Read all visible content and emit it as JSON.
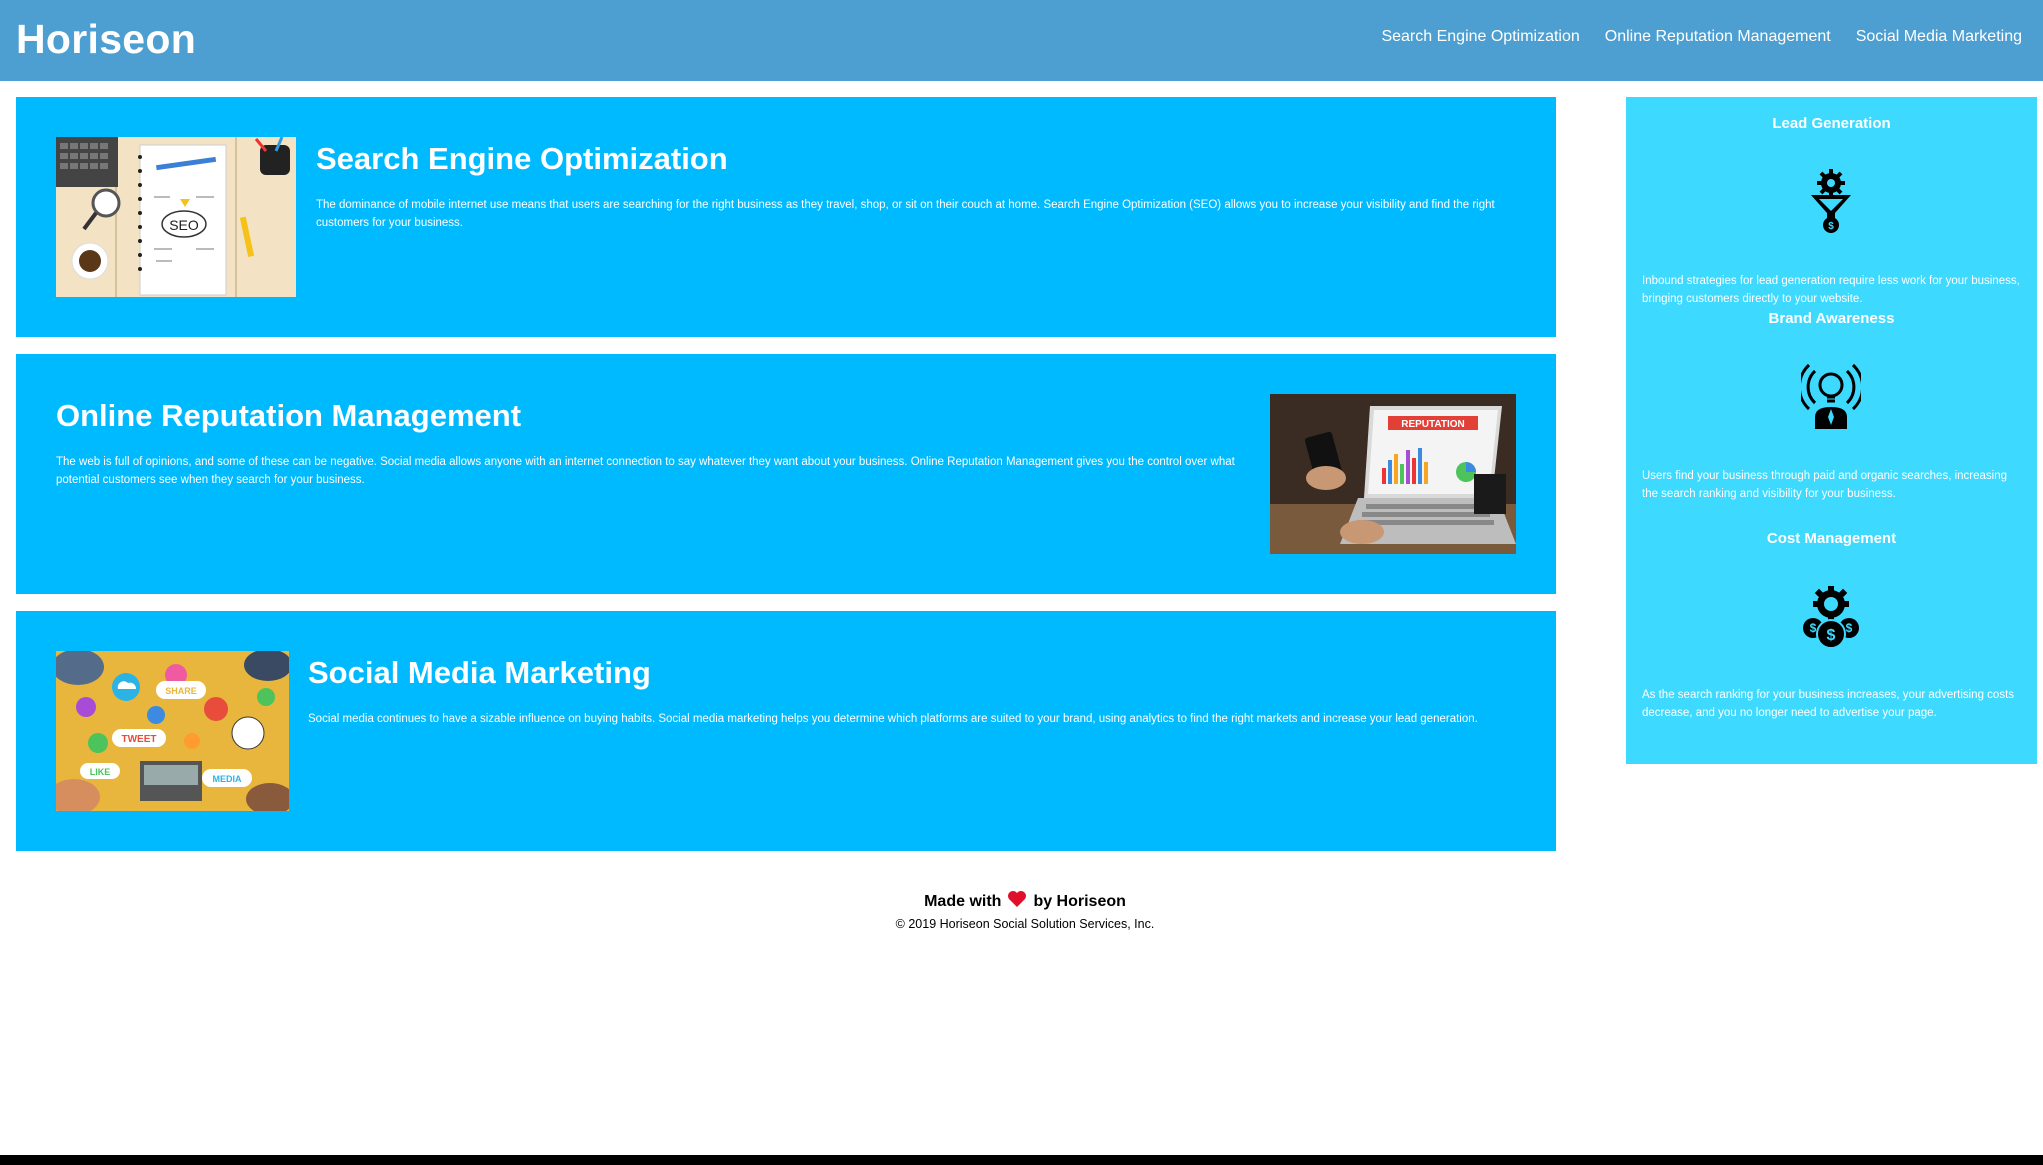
{
  "header": {
    "logo": "Horiseon",
    "nav": [
      {
        "label": "Search Engine Optimization"
      },
      {
        "label": "Online Reputation Management"
      },
      {
        "label": "Social Media Marketing"
      }
    ]
  },
  "main": {
    "cards": [
      {
        "title": "Search Engine Optimization",
        "text": "The dominance of mobile internet use means that users are searching for the right business as they travel, shop, or sit on their couch at home. Search Engine Optimization (SEO) allows you to increase your visibility and find the right customers for your business."
      },
      {
        "title": "Online Reputation Management",
        "text": "The web is full of opinions, and some of these can be negative. Social media allows anyone with an internet connection to say whatever they want about your business. Online Reputation Management gives you the control over what potential customers see when they search for your business."
      },
      {
        "title": "Social Media Marketing",
        "text": "Social media continues to have a sizable influence on buying habits. Social media marketing helps you determine which platforms are suited to your brand, using analytics to find the right markets and increase your lead generation."
      }
    ],
    "image_labels": {
      "seo": "SEO",
      "reputation": "REPUTATION",
      "tweet": "TWEET",
      "share": "SHARE",
      "like": "LIKE",
      "media": "MEDIA"
    }
  },
  "sidebar": {
    "benefits": [
      {
        "title": "Lead Generation",
        "icon": "lead-funnel-icon",
        "text": "Inbound strategies for lead generation require less work for your business, bringing customers directly to your website."
      },
      {
        "title": "Brand Awareness",
        "icon": "lightbulb-person-icon",
        "text": "Users find your business through paid and organic searches, increasing the search ranking and visibility for your business."
      },
      {
        "title": "Cost Management",
        "icon": "gear-coins-icon",
        "text": "As the search ranking for your business increases, your advertising costs decrease, and you no longer need to advertise your page."
      }
    ]
  },
  "footer": {
    "made_with": "Made with",
    "by": "by Horiseon",
    "copyright": "© 2019 Horiseon Social Solution Services, Inc."
  },
  "colors": {
    "header": "#4c9fd0",
    "card": "#00baff",
    "sidebar": "#3dd9ff",
    "heart": "#e0102a"
  }
}
